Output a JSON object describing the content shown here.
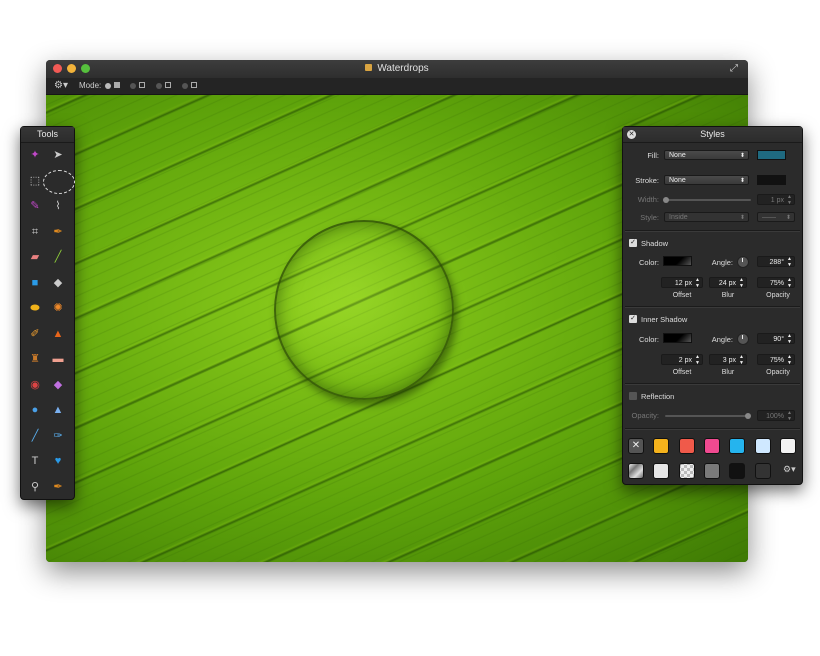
{
  "window": {
    "title": "Waterdrops",
    "toolbar": {
      "mode_label": "Mode:"
    }
  },
  "tools_panel": {
    "title": "Tools",
    "tools": [
      {
        "name": "magic-wand",
        "glyph": "✦",
        "color": "#c048c8"
      },
      {
        "name": "move",
        "glyph": "➤",
        "color": "#cccccc"
      },
      {
        "name": "rect-select",
        "glyph": "⬚",
        "color": "#cccccc"
      },
      {
        "name": "ellipse-select",
        "glyph": "",
        "color": "#cccccc"
      },
      {
        "name": "brush-select",
        "glyph": "✎",
        "color": "#c048c8"
      },
      {
        "name": "lasso",
        "glyph": "⌇",
        "color": "#cccccc"
      },
      {
        "name": "crop",
        "glyph": "⌗",
        "color": "#cccccc"
      },
      {
        "name": "eyedropper",
        "glyph": "✒",
        "color": "#e08a1f"
      },
      {
        "name": "eraser",
        "glyph": "▰",
        "color": "#e88080"
      },
      {
        "name": "pencil",
        "glyph": "╱",
        "color": "#8fd03a"
      },
      {
        "name": "shape",
        "glyph": "■",
        "color": "#2a9be8"
      },
      {
        "name": "paint-bucket",
        "glyph": "◆",
        "color": "#cccccc"
      },
      {
        "name": "gradient",
        "glyph": "⬬",
        "color": "#f0b21a"
      },
      {
        "name": "lollipop",
        "glyph": "✺",
        "color": "#f08a2a"
      },
      {
        "name": "smudge",
        "glyph": "✐",
        "color": "#f0a030"
      },
      {
        "name": "burn",
        "glyph": "▲",
        "color": "#e8651a"
      },
      {
        "name": "stamp",
        "glyph": "♜",
        "color": "#c97a2a"
      },
      {
        "name": "bandage",
        "glyph": "▬",
        "color": "#f0a090"
      },
      {
        "name": "red-eye",
        "glyph": "◉",
        "color": "#dd4444"
      },
      {
        "name": "sponge",
        "glyph": "◆",
        "color": "#c070e0"
      },
      {
        "name": "blur",
        "glyph": "●",
        "color": "#4aa0e8"
      },
      {
        "name": "sharpen",
        "glyph": "▲",
        "color": "#7ab0f0"
      },
      {
        "name": "line",
        "glyph": "╱",
        "color": "#5ab0f0"
      },
      {
        "name": "pen",
        "glyph": "✑",
        "color": "#5ab0f0"
      },
      {
        "name": "text",
        "glyph": "T",
        "color": "#cccccc"
      },
      {
        "name": "heart-shape",
        "glyph": "♥",
        "color": "#2a9be8"
      },
      {
        "name": "zoom",
        "glyph": "⚲",
        "color": "#cccccc"
      },
      {
        "name": "color-picker",
        "glyph": "✒",
        "color": "#e08a1f"
      }
    ]
  },
  "styles_panel": {
    "title": "Styles",
    "fill": {
      "label": "Fill:",
      "value": "None",
      "color": "#1f6a80"
    },
    "stroke": {
      "label": "Stroke:",
      "value": "None",
      "color": "#111111"
    },
    "width": {
      "label": "Width:",
      "value": "1 px"
    },
    "style": {
      "label": "Style:",
      "value": "Inside"
    },
    "shadow": {
      "title": "Shadow",
      "enabled": true,
      "color_label": "Color:",
      "angle_label": "Angle:",
      "angle": "288°",
      "offset": "12 px",
      "blur": "24 px",
      "opacity": "75%",
      "offset_label": "Offset",
      "blur_label": "Blur",
      "opacity_label": "Opacity"
    },
    "inner_shadow": {
      "title": "Inner Shadow",
      "enabled": true,
      "color_label": "Color:",
      "angle_label": "Angle:",
      "angle": "90°",
      "offset": "2 px",
      "blur": "3 px",
      "opacity": "75%",
      "offset_label": "Offset",
      "blur_label": "Blur",
      "opacity_label": "Opacity"
    },
    "reflection": {
      "title": "Reflection",
      "enabled": false,
      "opacity_label": "Opacity:",
      "opacity": "100%"
    },
    "presets": [
      {
        "name": "none",
        "bg": "#555555",
        "glyph": "✕"
      },
      {
        "name": "orange",
        "bg": "#f4b21c"
      },
      {
        "name": "red",
        "bg": "#f05a4a"
      },
      {
        "name": "pink",
        "bg": "#f04a90"
      },
      {
        "name": "blue",
        "bg": "#25b4ee"
      },
      {
        "name": "light-blue",
        "bg": "#cfe8ff"
      },
      {
        "name": "white",
        "bg": "#f2f2f2"
      },
      {
        "name": "metal",
        "bg": "#b8b8b8"
      },
      {
        "name": "silver",
        "bg": "#e6e6e6"
      },
      {
        "name": "checker",
        "bg": "#9a9a9a"
      },
      {
        "name": "gray",
        "bg": "#7a7a7a"
      },
      {
        "name": "black",
        "bg": "#111111"
      },
      {
        "name": "dark",
        "bg": "#333333"
      }
    ]
  }
}
